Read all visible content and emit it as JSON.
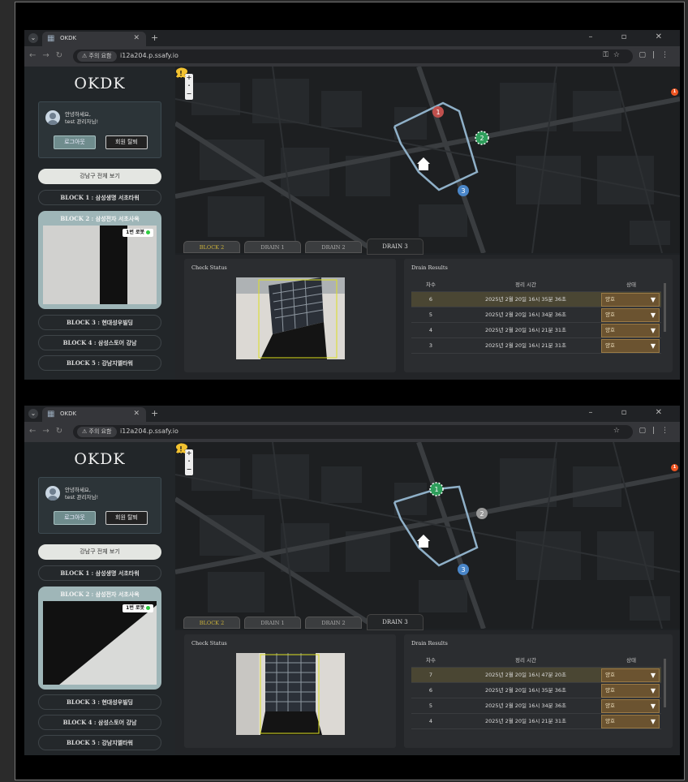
{
  "browser": {
    "tab_title": "OKDK",
    "tab_favicon": "app-favicon",
    "url": "i12a204.p.ssafy.io",
    "security_chip": "⚠ 주의 요함",
    "window_controls": "– ▫ ✕"
  },
  "app": {
    "logo": "OKDK",
    "greeting_line1": "안녕하세요,",
    "greeting_line2": "test 관리자님!",
    "logout_label": "로그아웃",
    "withdraw_label": "회원 탈퇴",
    "view_all_label": "강남구 전체 보기",
    "blocks": [
      "BLOCK 1 : 삼성생명 서초타워",
      "BLOCK 2 : 삼성전자 서초사옥",
      "BLOCK 3 : 현대성우빌딩",
      "BLOCK 4 : 삼성스토어 강남",
      "BLOCK 5 : 강남지엘타워"
    ],
    "camera_badge": "1번 로봇",
    "detail_tabs": [
      "BLOCK 2",
      "DRAIN 1",
      "DRAIN 2",
      "DRAIN 3"
    ],
    "check_status_title": "Check Status",
    "drain_results_title": "Drain Results",
    "table_headers": [
      "차수",
      "정리 시간",
      "상태"
    ],
    "markers": {
      "m1": "1",
      "m2": "2",
      "m3": "3"
    },
    "alert_count": "1"
  },
  "shot1": {
    "rows": [
      {
        "n": "6",
        "time": "2025년 2월 20일 16시 35분 36초",
        "status": "양호"
      },
      {
        "n": "5",
        "time": "2025년 2월 20일 16시 34분 36초",
        "status": "양호"
      },
      {
        "n": "4",
        "time": "2025년 2월 20일 16시 21분 31초",
        "status": "양호"
      },
      {
        "n": "3",
        "time": "2025년 2월 20일 16시 21분 31초",
        "status": "양호"
      }
    ]
  },
  "shot2": {
    "rows": [
      {
        "n": "7",
        "time": "2025년 2월 20일 16시 47분 20초",
        "status": "양호"
      },
      {
        "n": "6",
        "time": "2025년 2월 20일 16시 35분 36초",
        "status": "양호"
      },
      {
        "n": "5",
        "time": "2025년 2월 20일 16시 34분 36초",
        "status": "양호"
      },
      {
        "n": "4",
        "time": "2025년 2월 20일 16시 21분 31초",
        "status": "양호"
      }
    ]
  },
  "colors": {
    "accent_active_block": "#9fb6b8",
    "status_good": "#6b5330",
    "marker_red": "#c0504d",
    "marker_green": "#2e9e5b",
    "marker_blue": "#4a86c8",
    "route": "#8fb0c8"
  }
}
